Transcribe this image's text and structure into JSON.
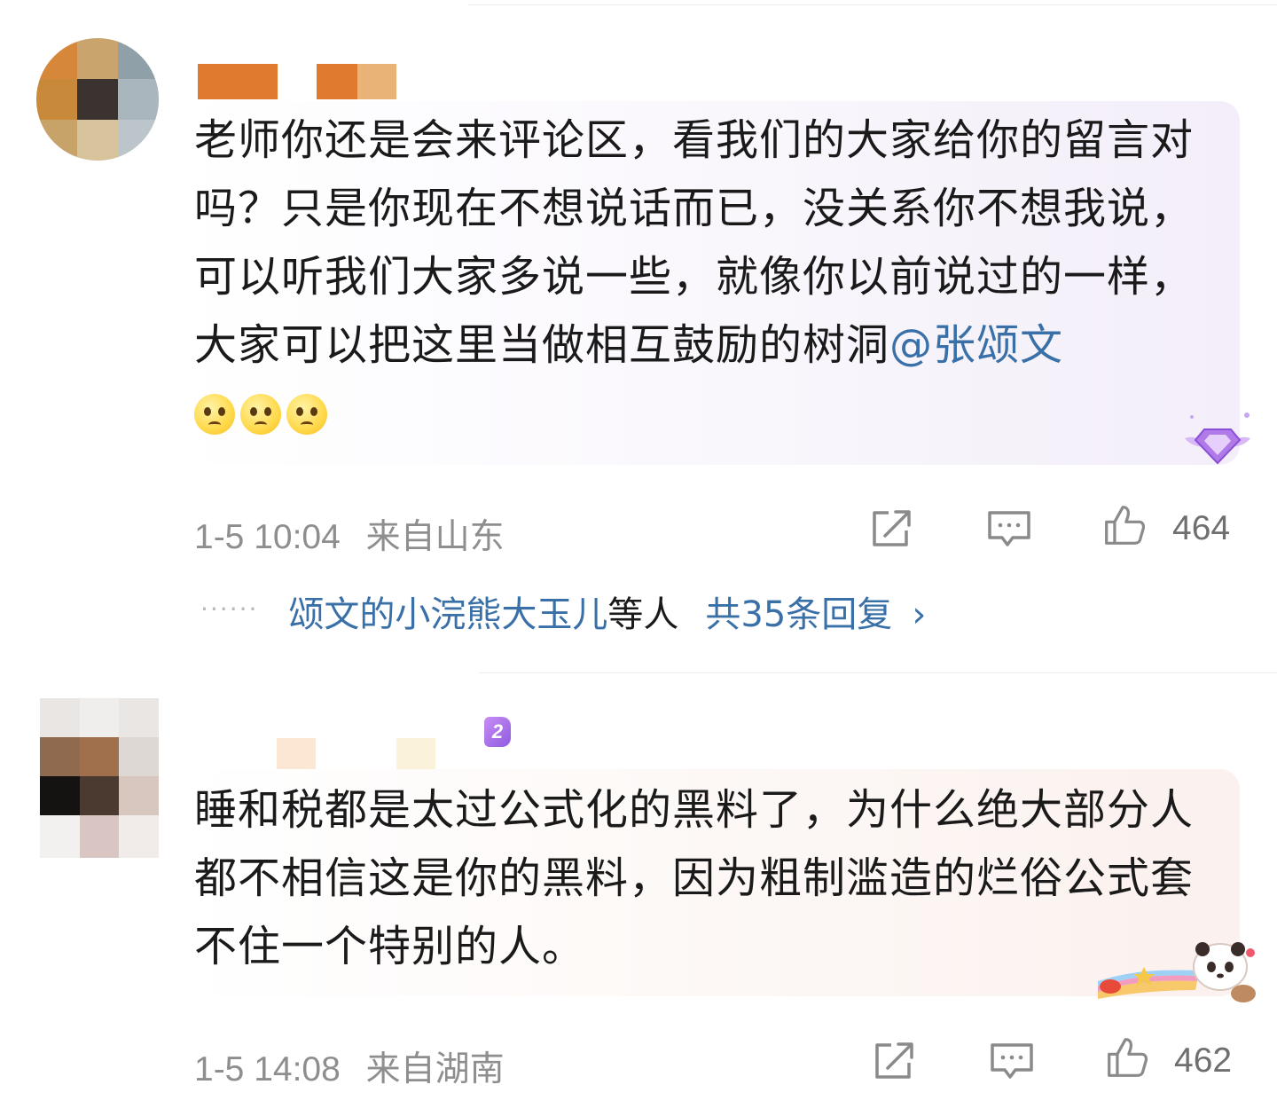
{
  "comments": [
    {
      "text": "老师你还是会来评论区，看我们的大家给你的留言对吗？只是你现在不想说话而已，没关系你不想我说，可以听我们大家多说一些，就像你以前说过的一样，大家可以把这里当做相互鼓励的树洞",
      "mention": "@张颂文",
      "emojis": [
        "pleading-face",
        "pleading-face",
        "pleading-face"
      ],
      "time": "1-5 10:04",
      "location": "来自山东",
      "likes": "464",
      "replies": {
        "dots": "······",
        "users": "颂文的小浣熊大玉儿",
        "etc": "等人",
        "total": "共35条回复",
        "chevron": "›"
      }
    },
    {
      "badge": "2",
      "text": "睡和税都是太过公式化的黑料了，为什么绝大部分人都不相信这是你的黑料，因为粗制滥造的烂俗公式套不住一个特别的人。",
      "time": "1-5 14:08",
      "location": "来自湖南",
      "likes": "462"
    }
  ],
  "icons": {
    "share": "share-icon",
    "comment": "comment-icon",
    "like": "thumbs-up-icon"
  },
  "colors": {
    "link": "#3a70a8",
    "meta": "#8e8e8e",
    "text": "#1a1a1a"
  }
}
